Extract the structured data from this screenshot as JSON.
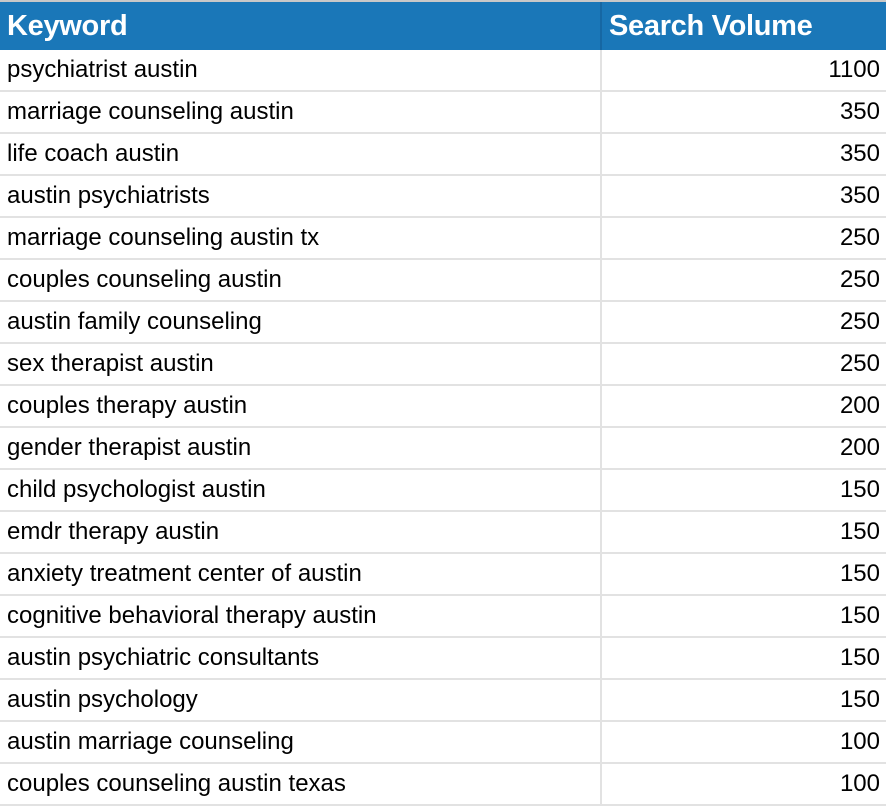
{
  "header": {
    "keyword": "Keyword",
    "volume": "Search Volume"
  },
  "colors": {
    "header_bg": "#1a77b8",
    "header_text": "#ffffff",
    "grid": "#e2e2e2"
  },
  "rows": [
    {
      "keyword": "psychiatrist austin",
      "volume": "1100"
    },
    {
      "keyword": "marriage counseling austin",
      "volume": "350"
    },
    {
      "keyword": "life coach austin",
      "volume": "350"
    },
    {
      "keyword": "austin psychiatrists",
      "volume": "350"
    },
    {
      "keyword": "marriage counseling austin tx",
      "volume": "250"
    },
    {
      "keyword": "couples counseling austin",
      "volume": "250"
    },
    {
      "keyword": "austin family counseling",
      "volume": "250"
    },
    {
      "keyword": "sex therapist austin",
      "volume": "250"
    },
    {
      "keyword": "couples therapy austin",
      "volume": "200"
    },
    {
      "keyword": "gender therapist austin",
      "volume": "200"
    },
    {
      "keyword": "child psychologist austin",
      "volume": "150"
    },
    {
      "keyword": "emdr therapy austin",
      "volume": "150"
    },
    {
      "keyword": "anxiety treatment center of austin",
      "volume": "150"
    },
    {
      "keyword": "cognitive behavioral therapy austin",
      "volume": "150"
    },
    {
      "keyword": "austin psychiatric consultants",
      "volume": "150"
    },
    {
      "keyword": "austin psychology",
      "volume": "150"
    },
    {
      "keyword": "austin marriage counseling",
      "volume": "100"
    },
    {
      "keyword": "couples counseling austin texas",
      "volume": "100"
    }
  ]
}
